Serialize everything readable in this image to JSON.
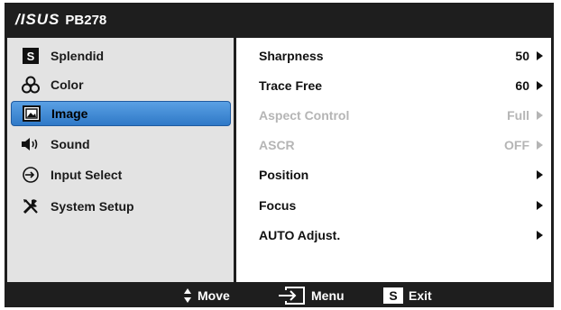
{
  "header": {
    "logo": "/ISUS",
    "model": "PB278"
  },
  "sidebar": {
    "items": [
      {
        "label": "Splendid",
        "icon": "s-box-icon",
        "active": false
      },
      {
        "label": "Color",
        "icon": "color-circles-icon",
        "active": false
      },
      {
        "label": "Image",
        "icon": "image-icon",
        "active": true
      },
      {
        "label": "Sound",
        "icon": "speaker-icon",
        "active": false
      },
      {
        "label": "Input Select",
        "icon": "input-arrow-icon",
        "active": false
      },
      {
        "label": "System Setup",
        "icon": "tools-icon",
        "active": false
      }
    ]
  },
  "main": {
    "rows": [
      {
        "label": "Sharpness",
        "value": "50",
        "disabled": false
      },
      {
        "label": "Trace Free",
        "value": "60",
        "disabled": false
      },
      {
        "label": "Aspect Control",
        "value": "Full",
        "disabled": true
      },
      {
        "label": "ASCR",
        "value": "OFF",
        "disabled": true
      },
      {
        "label": "Position",
        "value": "",
        "disabled": false
      },
      {
        "label": "Focus",
        "value": "",
        "disabled": false
      },
      {
        "label": "AUTO Adjust.",
        "value": "",
        "disabled": false
      }
    ]
  },
  "footer": {
    "move_label": "Move",
    "menu_label": "Menu",
    "exit_label": "Exit",
    "exit_key": "S"
  },
  "colors": {
    "frame": "#1e1e1e",
    "sidebar": "#e3e3e3",
    "accent": "#2f79c7",
    "disabled": "#b5b5b5"
  }
}
